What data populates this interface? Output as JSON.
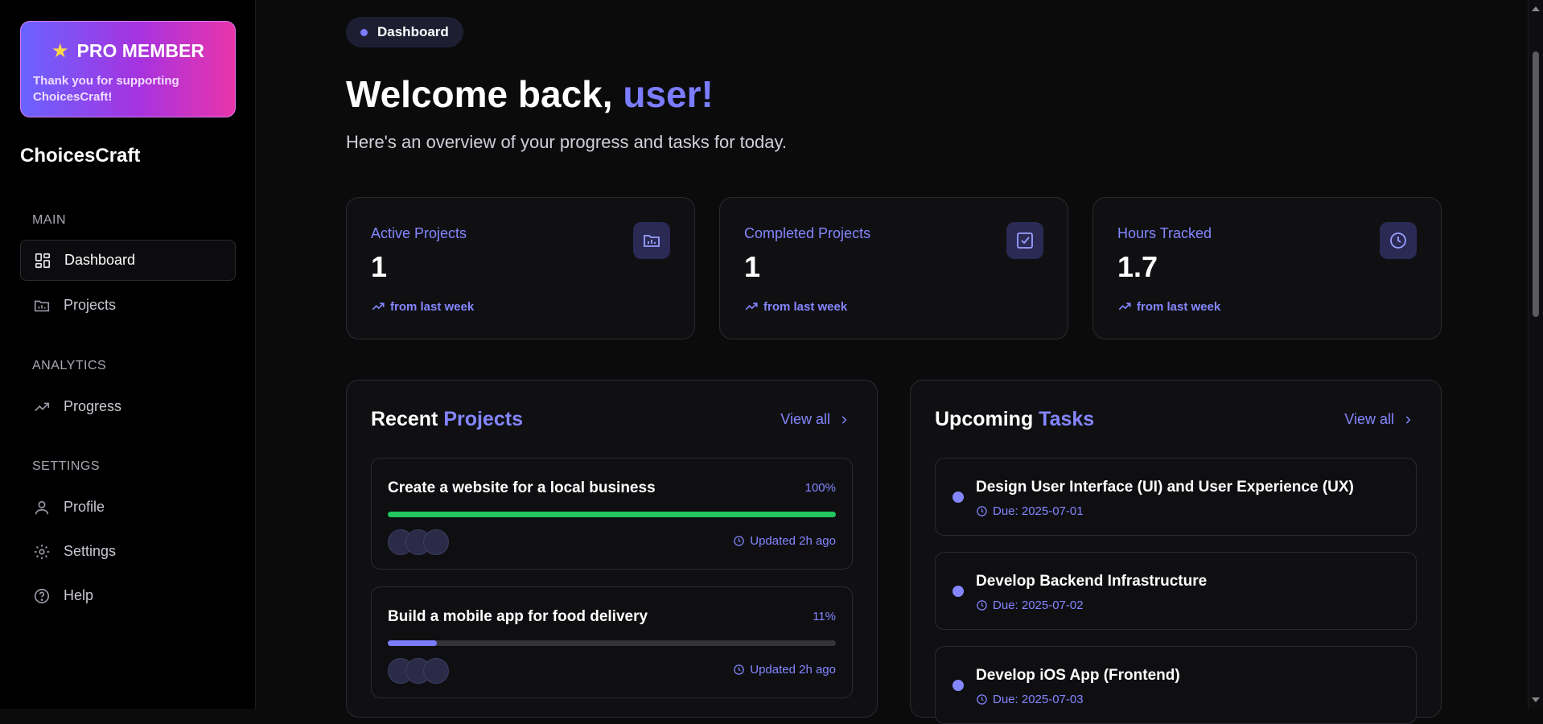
{
  "sidebar": {
    "pro": {
      "title": "PRO MEMBER",
      "text": "Thank you for supporting ChoicesCraft!"
    },
    "brand": "ChoicesCraft",
    "sections": {
      "main": "MAIN",
      "analytics": "ANALYTICS",
      "settings": "SETTINGS"
    },
    "items": {
      "dashboard": "Dashboard",
      "projects": "Projects",
      "progress": "Progress",
      "profile": "Profile",
      "settings": "Settings",
      "help": "Help"
    }
  },
  "header": {
    "breadcrumb": "Dashboard",
    "welcome": "Welcome back, ",
    "username": "user!",
    "subtitle": "Here's an overview of your progress and tasks for today."
  },
  "stats": [
    {
      "label": "Active Projects",
      "value": "1",
      "trend": "from last week",
      "icon": "folder-chart-icon"
    },
    {
      "label": "Completed Projects",
      "value": "1",
      "trend": "from last week",
      "icon": "check-square-icon"
    },
    {
      "label": "Hours Tracked",
      "value": "1.7",
      "trend": "from last week",
      "icon": "clock-icon"
    }
  ],
  "recent_projects": {
    "title_a": "Recent ",
    "title_b": "Projects",
    "view_all": "View all",
    "items": [
      {
        "name": "Create a website for a local business",
        "percent_label": "100%",
        "progress": 100,
        "color": "#22c55e",
        "updated": "Updated 2h ago"
      },
      {
        "name": "Build a mobile app for food delivery",
        "percent_label": "11%",
        "progress": 11,
        "color": "#7b7cff",
        "updated": "Updated 2h ago"
      }
    ]
  },
  "upcoming_tasks": {
    "title_a": "Upcoming ",
    "title_b": "Tasks",
    "view_all": "View all",
    "items": [
      {
        "name": "Design User Interface (UI) and User Experience (UX)",
        "due": "Due: 2025-07-01"
      },
      {
        "name": "Develop Backend Infrastructure",
        "due": "Due: 2025-07-02"
      },
      {
        "name": "Develop iOS App (Frontend)",
        "due": "Due: 2025-07-03"
      }
    ]
  },
  "colors": {
    "accent": "#7b7cff",
    "success": "#22c55e"
  }
}
